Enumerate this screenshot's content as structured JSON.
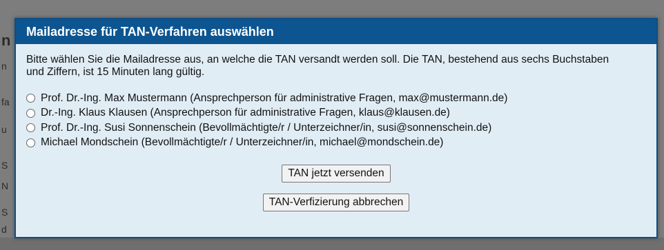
{
  "dialog": {
    "title": "Mailadresse für TAN-Verfahren auswählen",
    "intro": "Bitte wählen Sie die Mailadresse aus, an welche die TAN versandt werden soll. Die TAN, bestehend aus sechs Buchstaben und Ziffern, ist 15 Minuten lang gültig.",
    "options": [
      {
        "label": "Prof. Dr.-Ing. Max Mustermann (Ansprechperson für administrative Fragen, max@mustermann.de)",
        "selected": false
      },
      {
        "label": "Dr.-Ing. Klaus Klausen (Ansprechperson für administrative Fragen, klaus@klausen.de)",
        "selected": false
      },
      {
        "label": "Prof. Dr.-Ing. Susi Sonnenschein (Bevollmächtigte/r / Unterzeichner/in, susi@sonnenschein.de)",
        "selected": false
      },
      {
        "label": "Michael Mondschein (Bevollmächtigte/r / Unterzeichner/in, michael@mondschein.de)",
        "selected": false
      }
    ],
    "send_button": "TAN jetzt versenden",
    "cancel_button": "TAN-Verfizierung abbrechen"
  },
  "colors": {
    "header_bg": "#0d5590",
    "dialog_bg": "#e1edf5",
    "overlay": "#7d7d7d"
  }
}
